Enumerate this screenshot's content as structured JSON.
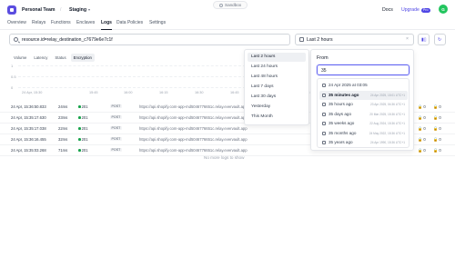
{
  "header": {
    "sandbox_label": "Sandbox",
    "team": "Personal Team",
    "separator": "/",
    "environment": "Staging",
    "docs": "Docs",
    "upgrade": "Upgrade",
    "upgrade_badge": "Pro",
    "avatar_initial": "G"
  },
  "nav": {
    "tabs": [
      {
        "label": "Overview"
      },
      {
        "label": "Relays"
      },
      {
        "label": "Functions"
      },
      {
        "label": "Enclaves"
      },
      {
        "label": "Logs",
        "active": true
      },
      {
        "label": "Data Policies"
      },
      {
        "label": "Settings"
      }
    ]
  },
  "filters": {
    "search_value": "resource.id=relay_destination_c7679e6e7c1f",
    "date_range": "Last 2 hours",
    "clear_glyph": "×"
  },
  "chart": {
    "tabs": [
      {
        "label": "Volume"
      },
      {
        "label": "Latency"
      },
      {
        "label": "Status"
      },
      {
        "label": "Encryption",
        "active": true
      }
    ],
    "y_labels": [
      "1",
      "0.5",
      "0"
    ],
    "x_labels": [
      "24 Apr, 15:30",
      "15:45",
      "16:00",
      "16:15",
      "16:30",
      "16:45",
      "17:00",
      "17:15"
    ]
  },
  "logs": {
    "rows": [
      {
        "time": "24 Apr, 15:36:50.833",
        "duration": "24ms",
        "status": "201",
        "method": "POST",
        "url": "https://api.shopify.com-app-md5046776651c.relay.evervault.app",
        "enc": "0",
        "dec": "0"
      },
      {
        "time": "24 Apr, 15:35:17.630",
        "duration": "23ms",
        "status": "201",
        "method": "POST",
        "url": "https://api.shopify.com-app-md5046776651c.relay.evervault.app",
        "enc": "0",
        "dec": "0"
      },
      {
        "time": "24 Apr, 15:35:17.038",
        "duration": "22ms",
        "status": "201",
        "method": "POST",
        "url": "https://api.shopify.com-app-md5046776651c.relay.evervault.app",
        "enc": "0",
        "dec": "0"
      },
      {
        "time": "24 Apr, 15:36:16.455",
        "duration": "32ms",
        "status": "201",
        "method": "POST",
        "url": "https://api.shopify.com-app-md5046776651c.relay.evervault.app",
        "enc": "0",
        "dec": "0"
      },
      {
        "time": "24 Apr, 15:35:03.268",
        "duration": "71ms",
        "status": "201",
        "method": "POST",
        "url": "https://api.shopify.com-app-md5046776651c.relay.evervault.app",
        "enc": "0",
        "dec": "0"
      }
    ],
    "no_more": "No more logs to show"
  },
  "time_menu": {
    "items": [
      {
        "label": "Last 2 hours",
        "active": true
      },
      {
        "label": "Last 24 hours"
      },
      {
        "label": "Last 48 hours"
      },
      {
        "label": "Last 7 days"
      },
      {
        "label": "Last 30 days"
      },
      {
        "label": "Yesterday"
      },
      {
        "label": "This Month"
      }
    ]
  },
  "from_panel": {
    "label": "From",
    "input_value": "35",
    "suggestions": [
      {
        "label": "24 Apr 2025 at 03:05",
        "date": ""
      },
      {
        "label": "35 minutes ago",
        "date": "24 Apr 2025, 15:01 UTC+1",
        "active": true
      },
      {
        "label": "35 hours ago",
        "date": "23 Apr 2025, 04:36 UTC+1"
      },
      {
        "label": "35 days ago",
        "date": "20 Mar 2025, 15:36 UTC+1"
      },
      {
        "label": "35 weeks ago",
        "date": "22 Aug 2024, 15:36 UTC+1"
      },
      {
        "label": "35 months ago",
        "date": "24 May 2022, 15:36 UTC+1"
      },
      {
        "label": "35 years ago",
        "date": "24 Apr 1990, 15:36 UTC+1"
      }
    ]
  },
  "colors": {
    "brand": "#5b4de0",
    "accent": "#4f46e5",
    "status_ok": "#16a34a",
    "avatar": "#22c55e"
  }
}
